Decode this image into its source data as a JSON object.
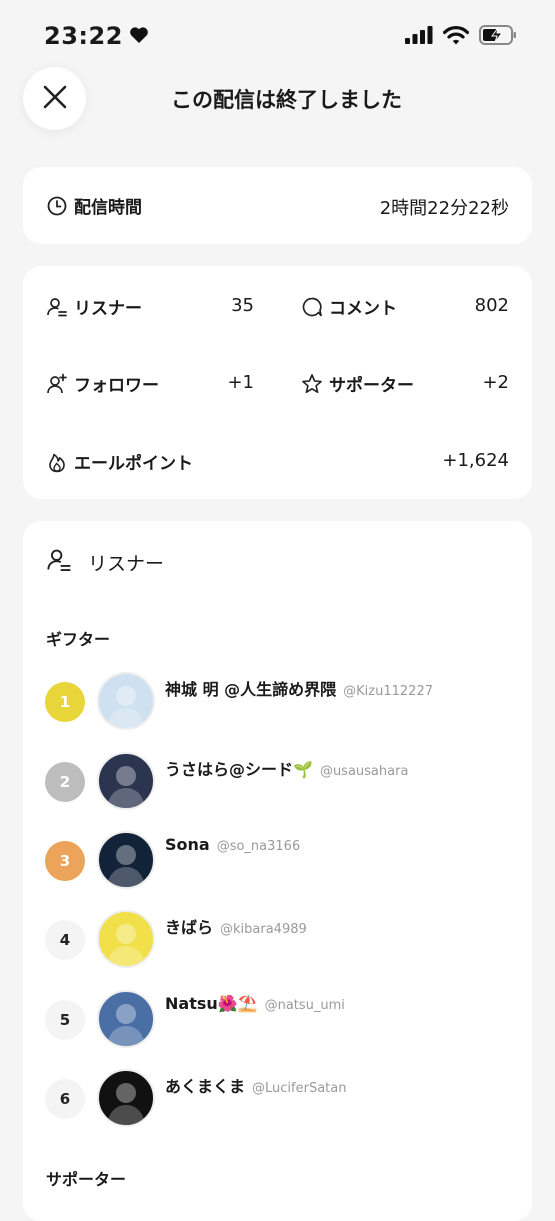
{
  "status_bar": {
    "time": "23:22",
    "heart_icon": "heart-icon",
    "signal_icon": "cellular-signal-icon",
    "wifi_icon": "wifi-icon",
    "battery_icon": "battery-charging-icon"
  },
  "header": {
    "close_icon": "close-icon",
    "title": "この配信は終了しました"
  },
  "duration": {
    "label": "配信時間",
    "value": "2時間22分22秒",
    "icon": "clock-icon"
  },
  "stats": {
    "listeners": {
      "label": "リスナー",
      "value": "35",
      "icon": "person-lines-icon"
    },
    "comments": {
      "label": "コメント",
      "value": "802",
      "icon": "speech-bubble-icon"
    },
    "followers": {
      "label": "フォロワー",
      "value": "+1",
      "icon": "person-add-icon"
    },
    "supporters": {
      "label": "サポーター",
      "value": "+2",
      "icon": "star-icon"
    },
    "yell_points": {
      "label": "エールポイント",
      "value": "+1,624",
      "icon": "flame-icon"
    }
  },
  "listeners_section": {
    "title": "リスナー",
    "icon": "person-lines-icon",
    "gifter_heading": "ギフター",
    "supporter_heading": "サポーター",
    "gifters": [
      {
        "rank": "1",
        "name": "神城 明 @人生諦め界隈",
        "handle": "@Kizu112227",
        "badge_color": "#e8d53a",
        "badge_text": "#ffffff",
        "avatar_color": "#cfe0f0"
      },
      {
        "rank": "2",
        "name": "うさはら@シード🌱",
        "handle": "@usausahara",
        "badge_color": "#bdbdbd",
        "badge_text": "#ffffff",
        "avatar_color": "#2b3550"
      },
      {
        "rank": "3",
        "name": "Sona",
        "handle": "@so_na3166",
        "badge_color": "#eca35a",
        "badge_text": "#ffffff",
        "avatar_color": "#122238"
      },
      {
        "rank": "4",
        "name": "きばら",
        "handle": "@kibara4989",
        "badge_color": "#f4f4f4",
        "badge_text": "#222222",
        "avatar_color": "#f2e04a"
      },
      {
        "rank": "5",
        "name": "Natsu🌺⛱️",
        "handle": "@natsu_umi",
        "badge_color": "#f4f4f4",
        "badge_text": "#222222",
        "avatar_color": "#4a6fa5"
      },
      {
        "rank": "6",
        "name": "あくまくま",
        "handle": "@LuciferSatan",
        "badge_color": "#f4f4f4",
        "badge_text": "#222222",
        "avatar_color": "#111111"
      }
    ]
  }
}
